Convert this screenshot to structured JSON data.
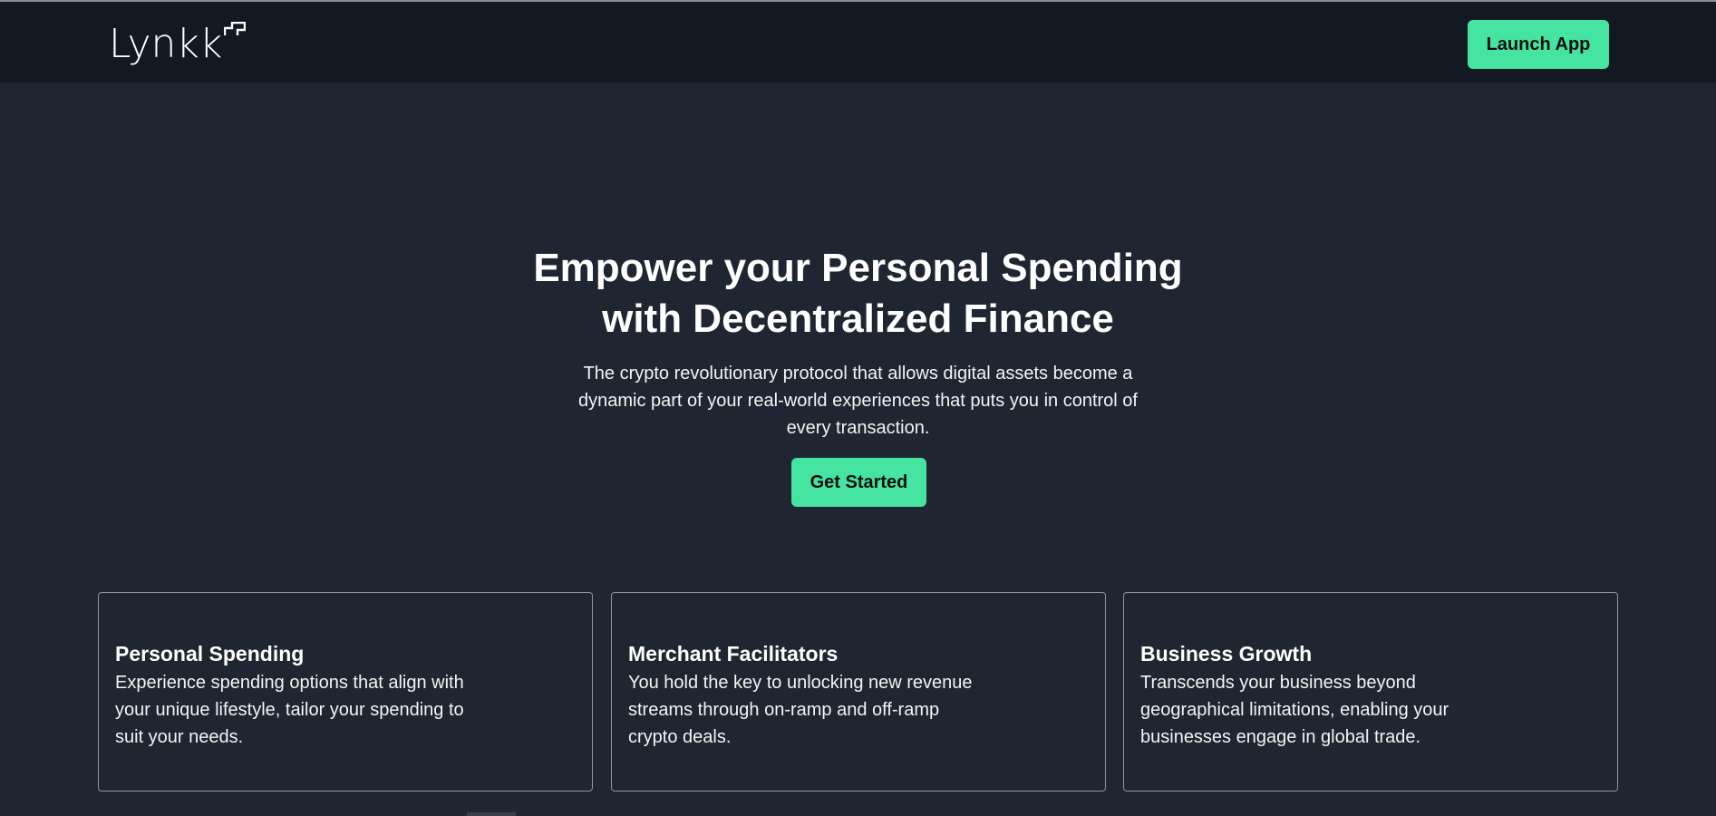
{
  "header": {
    "logo_text": "Lynkk",
    "launch_label": "Launch App"
  },
  "hero": {
    "title_lines": [
      "Empower your Personal Spending",
      "with Decentralized Finance"
    ],
    "subtitle_lines": [
      "The crypto revolutionary protocol that allows digital assets become a",
      "dynamic part of your real-world experiences that puts you in control of",
      "every transaction."
    ],
    "cta_label": "Get Started"
  },
  "cards": [
    {
      "title": "Personal Spending",
      "desc_lines": [
        "Experience spending options that align with",
        "your unique lifestyle, tailor your spending to",
        "suit your needs."
      ]
    },
    {
      "title": "Merchant Facilitators",
      "desc_lines": [
        "You hold the key to unlocking new revenue",
        "streams through on-ramp and off-ramp",
        "crypto deals."
      ]
    },
    {
      "title": "Business Growth",
      "desc_lines": [
        "Transcends your business beyond",
        "geographical limitations, enabling your",
        "businesses engage in global trade."
      ]
    }
  ],
  "colors": {
    "accent": "#45e4a0",
    "header_bg": "#121923",
    "page_bg": "#202631"
  }
}
